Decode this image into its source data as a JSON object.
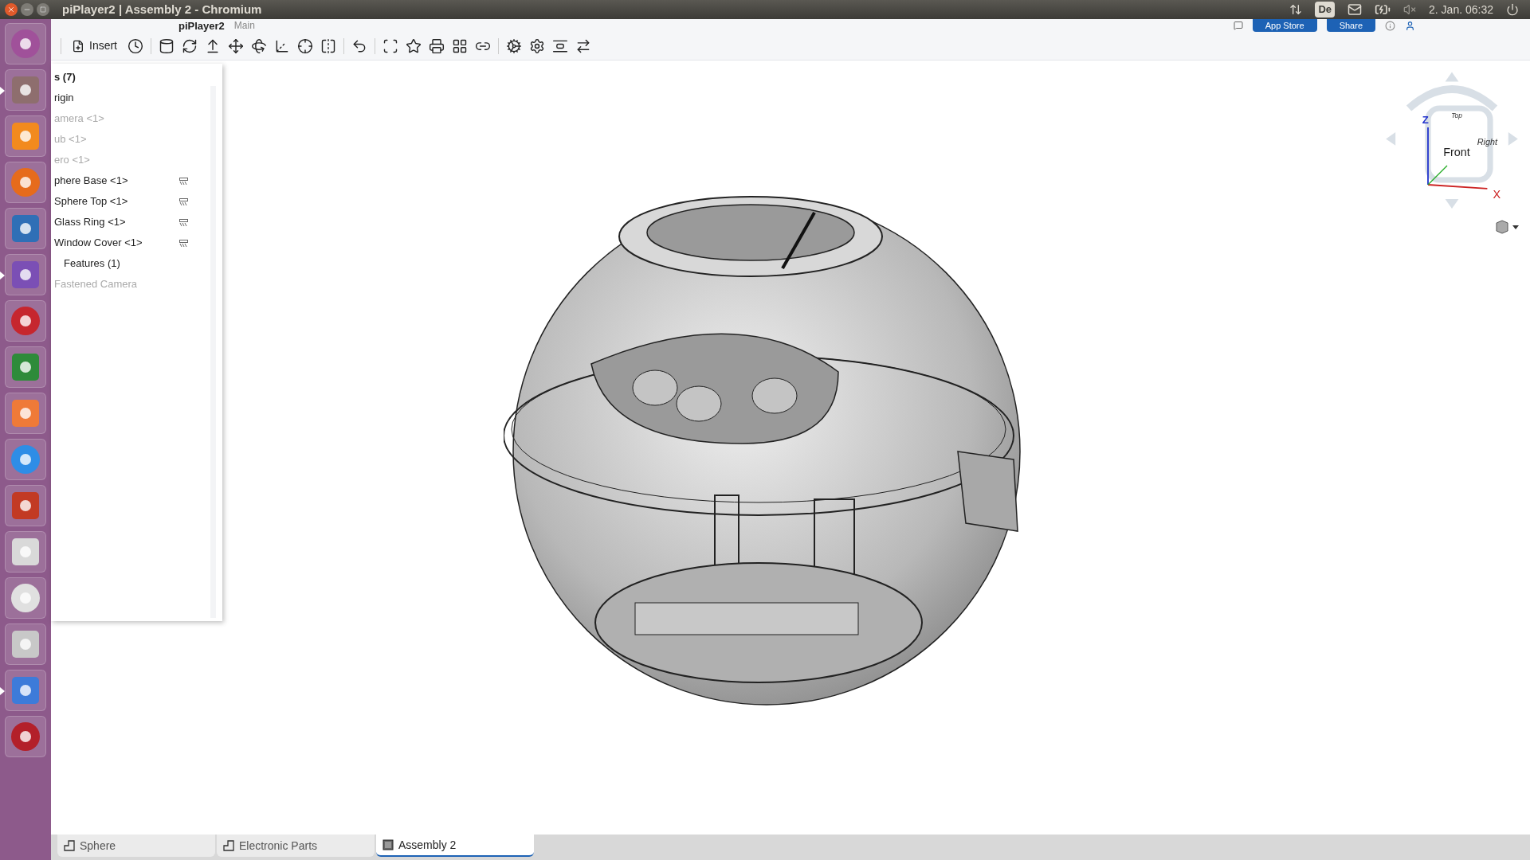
{
  "window": {
    "title": "piPlayer2 | Assembly 2 - Chromium"
  },
  "system_tray": {
    "keyboard": "De",
    "clock": "2. Jan. 06:32"
  },
  "launcher": [
    {
      "running": false
    },
    {
      "running": true
    },
    {
      "running": false
    },
    {
      "running": false
    },
    {
      "running": false
    },
    {
      "running": true
    },
    {
      "running": false
    },
    {
      "running": false
    },
    {
      "running": false
    },
    {
      "running": false
    },
    {
      "running": false
    },
    {
      "running": false
    },
    {
      "running": false
    },
    {
      "running": false
    },
    {
      "running": true
    },
    {
      "running": false
    }
  ],
  "header": {
    "document": "piPlayer2",
    "workspace": "Main",
    "buttons": [
      "App Store",
      "Share"
    ]
  },
  "toolbar": {
    "insert": "Insert"
  },
  "feature_tree": [
    {
      "label": "s (7)",
      "kind": "heading",
      "disabled": false,
      "mate": false
    },
    {
      "label": "rigin",
      "kind": "item",
      "disabled": false,
      "mate": false
    },
    {
      "label": "amera <1>",
      "kind": "item",
      "disabled": true,
      "mate": false
    },
    {
      "label": "ub <1>",
      "kind": "item",
      "disabled": true,
      "mate": false
    },
    {
      "label": "ero <1>",
      "kind": "item",
      "disabled": true,
      "mate": false
    },
    {
      "label": "phere Base <1>",
      "kind": "item",
      "disabled": false,
      "mate": true
    },
    {
      "label": "Sphere Top <1>",
      "kind": "item",
      "disabled": false,
      "mate": true
    },
    {
      "label": "Glass Ring <1>",
      "kind": "item",
      "disabled": false,
      "mate": true
    },
    {
      "label": "Window Cover <1>",
      "kind": "item",
      "disabled": false,
      "mate": true
    },
    {
      "label": "Features (1)",
      "kind": "heading",
      "disabled": false,
      "mate": false
    },
    {
      "label": "Fastened Camera",
      "kind": "item",
      "disabled": true,
      "mate": false
    }
  ],
  "view_cube": {
    "front": "Front",
    "top": "Top",
    "right": "Right",
    "z_axis": "Z",
    "x_axis": "X"
  },
  "tabs": [
    {
      "label": "Sphere",
      "kind": "part",
      "selected": false
    },
    {
      "label": "Electronic Parts",
      "kind": "part",
      "selected": false
    },
    {
      "label": "Assembly 2",
      "kind": "assembly",
      "selected": true
    }
  ]
}
